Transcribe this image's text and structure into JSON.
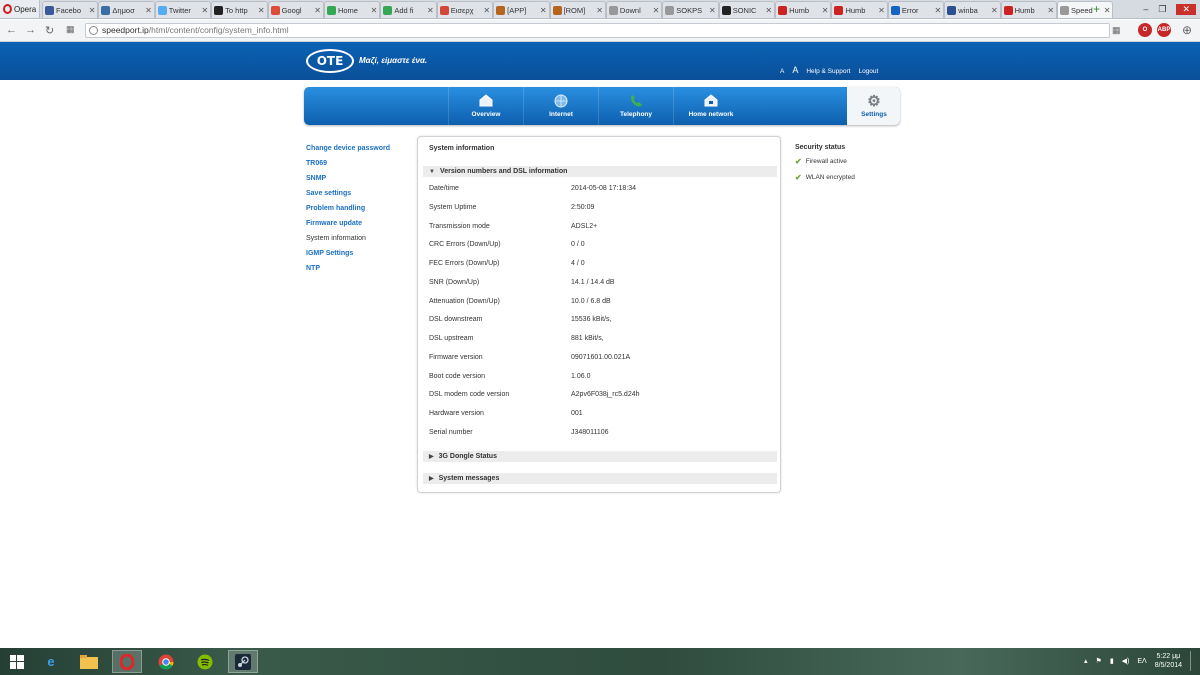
{
  "browser": {
    "app_name": "Opera",
    "tabs": [
      {
        "title": "Facebo",
        "color": "#3b5998"
      },
      {
        "title": "Δημοσ",
        "color": "#3a6ea5"
      },
      {
        "title": "Twitter",
        "color": "#55acee"
      },
      {
        "title": "To http",
        "color": "#222222"
      },
      {
        "title": "Googl",
        "color": "#dd4b39"
      },
      {
        "title": "Home",
        "color": "#34a853"
      },
      {
        "title": "Add fi",
        "color": "#34a853"
      },
      {
        "title": "Εισερχ",
        "color": "#d44638"
      },
      {
        "title": "[APP]",
        "color": "#b5651d"
      },
      {
        "title": "[ROM]",
        "color": "#b5651d"
      },
      {
        "title": "Downl",
        "color": "#999999"
      },
      {
        "title": "SOKPS",
        "color": "#999999"
      },
      {
        "title": "SONIC",
        "color": "#222222"
      },
      {
        "title": "Humb",
        "color": "#cc2222"
      },
      {
        "title": "Humb",
        "color": "#cc2222"
      },
      {
        "title": "Error",
        "color": "#1565c0"
      },
      {
        "title": "winba",
        "color": "#2b4f8f"
      },
      {
        "title": "Humb",
        "color": "#cc2222"
      },
      {
        "title": "Speed",
        "color": "#999999"
      }
    ],
    "url_host": "speedport.ip",
    "url_path": "/html/content/config/system_info.html",
    "ext_label": "ABP"
  },
  "header": {
    "logo": "ΟΤΕ",
    "slogan": "Μαζί, είμαστε ένα.",
    "font_small": "A",
    "font_big": "A",
    "help": "Help & Support",
    "logout": "Logout"
  },
  "nav": {
    "items": [
      {
        "label": "Overview",
        "icon": "house-icon"
      },
      {
        "label": "Internet",
        "icon": "globe-icon"
      },
      {
        "label": "Telephony",
        "icon": "phone-icon"
      },
      {
        "label": "Home network",
        "icon": "home-network-icon"
      },
      {
        "label": "Settings",
        "icon": "gear-icon"
      }
    ]
  },
  "leftmenu": [
    "Change device password",
    "TR069",
    "SNMP",
    "Save settings",
    "Problem handling",
    "Firmware update",
    "System information",
    "IGMP Settings",
    "NTP"
  ],
  "panel": {
    "title": "System information",
    "section_open": "Version numbers and DSL information",
    "section_2": "3G Dongle Status",
    "section_3": "System messages",
    "rows": [
      {
        "label": "Date/time",
        "value": "2014-05-08 17:18:34"
      },
      {
        "label": "System Uptime",
        "value": "2:50:09"
      },
      {
        "label": "Transmission mode",
        "value": "ADSL2+"
      },
      {
        "label": "CRC Errors (Down/Up)",
        "value": "0 / 0"
      },
      {
        "label": "FEC Errors (Down/Up)",
        "value": "4 / 0"
      },
      {
        "label": "SNR (Down/Up)",
        "value": "14.1 / 14.4 dB"
      },
      {
        "label": "Attenuation (Down/Up)",
        "value": "10.0 / 6.8 dB"
      },
      {
        "label": "DSL downstream",
        "value": "15536 kBit/s,"
      },
      {
        "label": "DSL upstream",
        "value": "881 kBit/s,"
      },
      {
        "label": "Firmware version",
        "value": "09071601.00.021A"
      },
      {
        "label": "Boot code version",
        "value": "1.06.0"
      },
      {
        "label": "DSL modem code version",
        "value": "A2pv6F038j_rc5.d24h"
      },
      {
        "label": "Hardware version",
        "value": "001"
      },
      {
        "label": "Serial number",
        "value": "J348011106"
      }
    ]
  },
  "security": {
    "title": "Security status",
    "items": [
      "Firewall active",
      "WLAN encrypted"
    ]
  },
  "taskbar": {
    "lang": "ΕΛ",
    "time": "5:22 μμ",
    "date": "8/5/2014"
  }
}
